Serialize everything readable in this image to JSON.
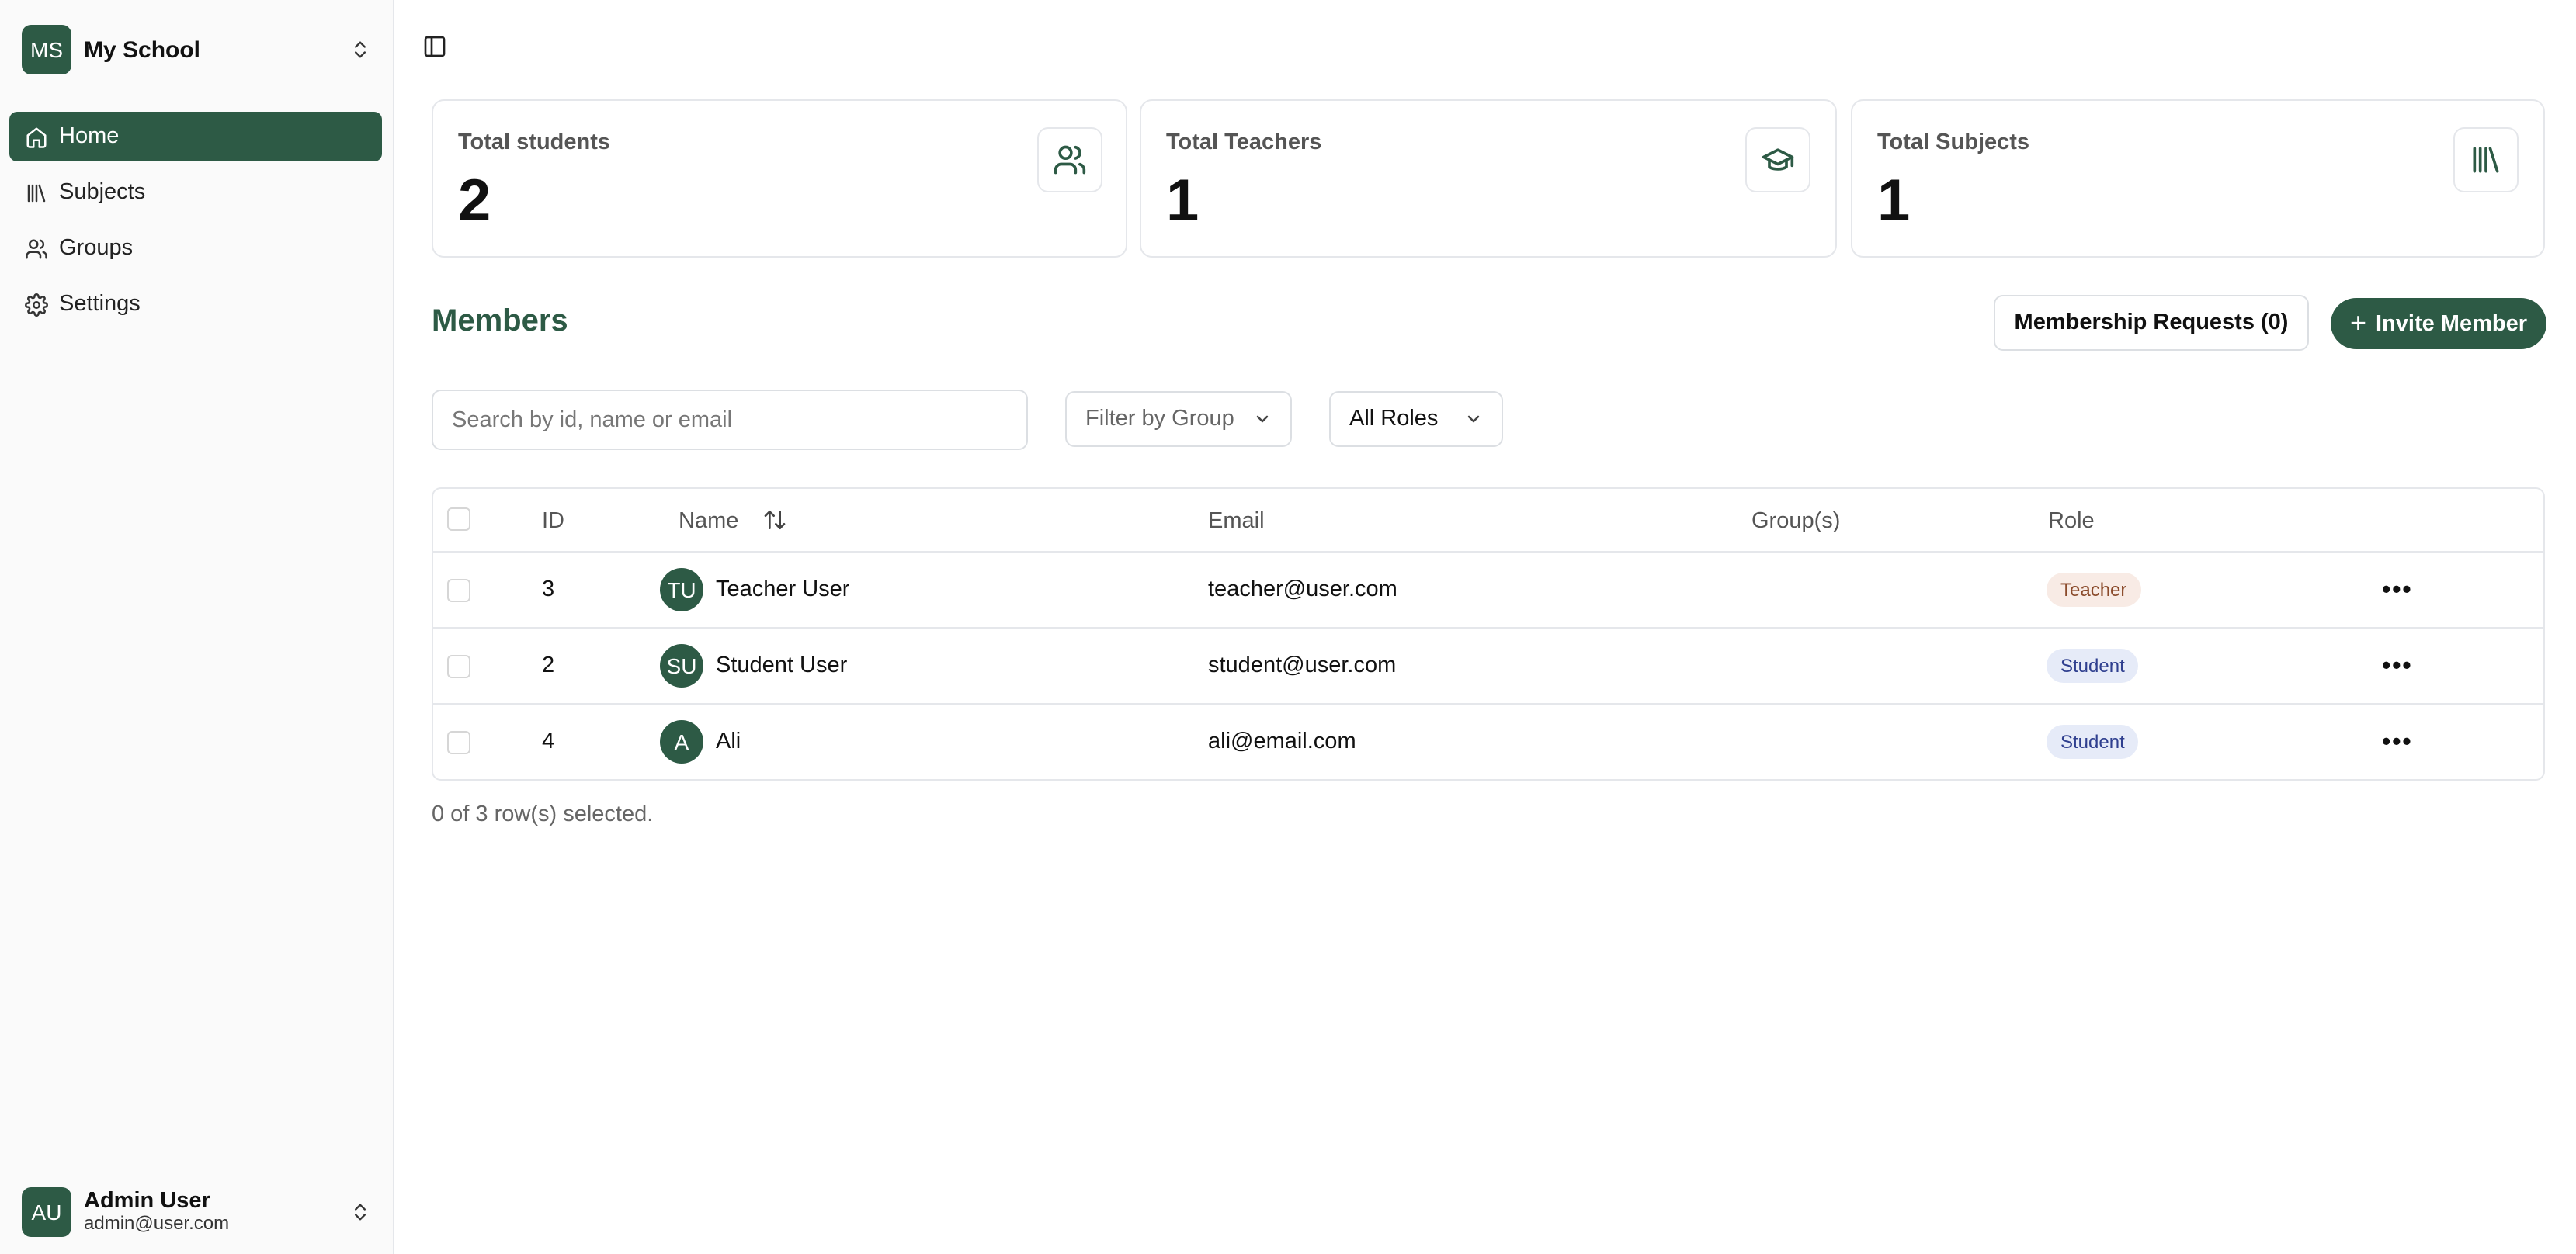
{
  "sidebar": {
    "school": {
      "initials": "MS",
      "name": "My School"
    },
    "nav": [
      {
        "label": "Home",
        "icon": "home-icon",
        "active": true
      },
      {
        "label": "Subjects",
        "icon": "library-icon",
        "active": false
      },
      {
        "label": "Groups",
        "icon": "users-icon",
        "active": false
      },
      {
        "label": "Settings",
        "icon": "gear-icon",
        "active": false
      }
    ],
    "user": {
      "initials": "AU",
      "name": "Admin User",
      "email": "admin@user.com"
    }
  },
  "stats": [
    {
      "label": "Total students",
      "value": "2",
      "icon": "users-icon"
    },
    {
      "label": "Total Teachers",
      "value": "1",
      "icon": "graduation-cap-icon"
    },
    {
      "label": "Total Subjects",
      "value": "1",
      "icon": "library-icon"
    }
  ],
  "members": {
    "title": "Members",
    "requests_label": "Membership Requests (0)",
    "invite_label": "Invite Member",
    "search_placeholder": "Search by id, name or email",
    "group_filter": "Filter by Group",
    "role_filter": "All Roles",
    "columns": {
      "id": "ID",
      "name": "Name",
      "email": "Email",
      "groups": "Group(s)",
      "role": "Role"
    },
    "rows": [
      {
        "id": "3",
        "initials": "TU",
        "name": "Teacher User",
        "email": "teacher@user.com",
        "groups": "",
        "role": "Teacher"
      },
      {
        "id": "2",
        "initials": "SU",
        "name": "Student User",
        "email": "student@user.com",
        "groups": "",
        "role": "Student"
      },
      {
        "id": "4",
        "initials": "A",
        "name": "Ali",
        "email": "ali@email.com",
        "groups": "",
        "role": "Student"
      }
    ],
    "selection_text": "0 of 3 row(s) selected."
  },
  "colors": {
    "brand": "#2d5a45",
    "teacher_badge": "#f8ebe5",
    "student_badge": "#e6ebf8"
  }
}
